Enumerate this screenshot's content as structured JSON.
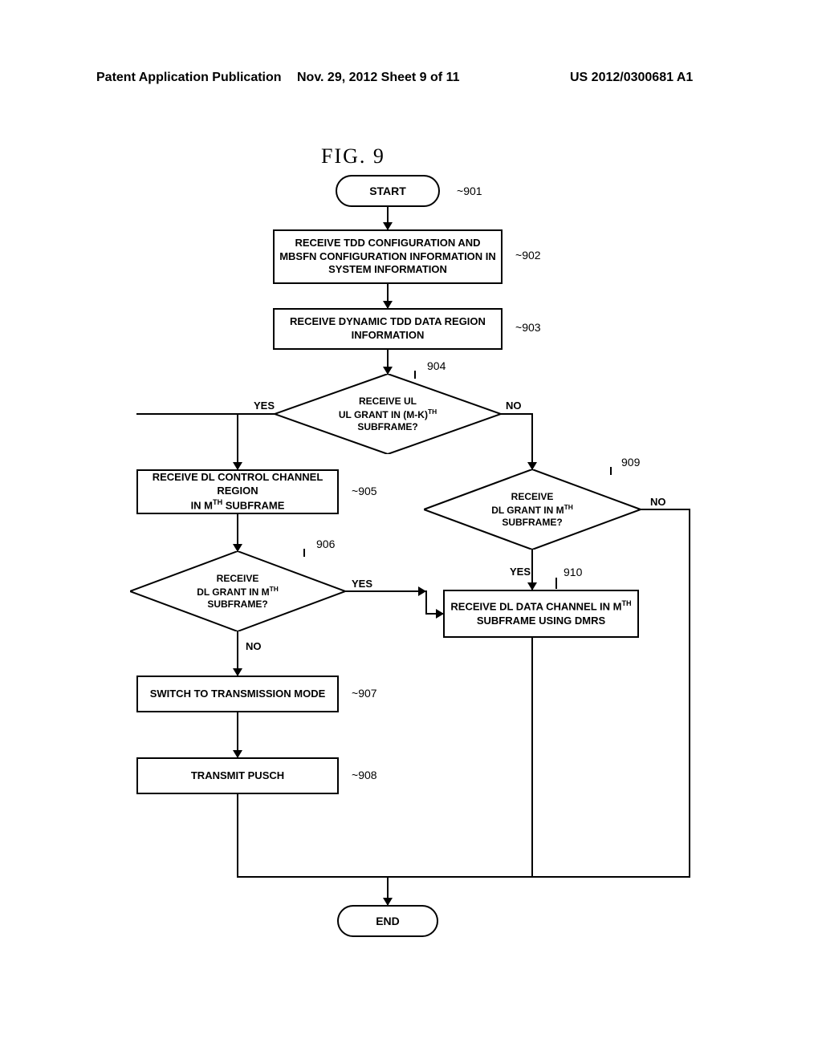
{
  "header": {
    "left": "Patent Application Publication",
    "mid": "Nov. 29, 2012  Sheet 9 of 11",
    "right": "US 2012/0300681 A1"
  },
  "figure": {
    "title": "FIG. 9",
    "start": "START",
    "end": "END",
    "box902": "RECEIVE TDD CONFIGURATION AND MBSFN CONFIGURATION INFORMATION IN SYSTEM INFORMATION",
    "box903": "RECEIVE DYNAMIC TDD DATA REGION INFORMATION",
    "d904_l1": "RECEIVE UL",
    "d904_l2": "UL GRANT IN (M-K)",
    "d904_l3": "SUBFRAME?",
    "box905_l1": "RECEIVE DL CONTROL CHANNEL REGION",
    "box905_l2": "IN M",
    "box905_l3": " SUBFRAME",
    "d906_l1": "RECEIVE",
    "d906_l2": "DL GRANT IN M",
    "d906_l3": "SUBFRAME?",
    "box907": "SWITCH TO TRANSMISSION MODE",
    "box908": "TRANSMIT PUSCH",
    "d909_l1": "RECEIVE",
    "d909_l2": "DL GRANT IN M",
    "d909_l3": "SUBFRAME?",
    "box910_l1": "RECEIVE DL DATA CHANNEL IN M",
    "box910_l2": "SUBFRAME USING DMRS",
    "yes": "YES",
    "no": "NO",
    "ref901": "901",
    "ref902": "902",
    "ref903": "903",
    "ref904": "904",
    "ref905": "905",
    "ref906": "906",
    "ref907": "907",
    "ref908": "908",
    "ref909": "909",
    "ref910": "910"
  }
}
